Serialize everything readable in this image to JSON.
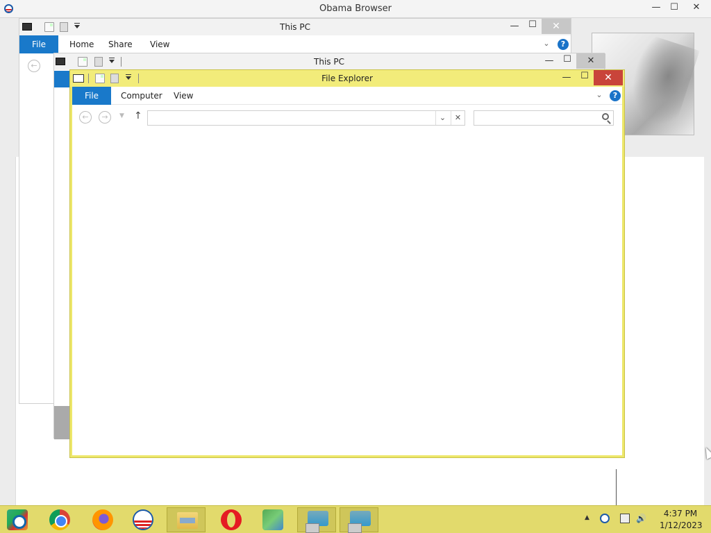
{
  "browser": {
    "title": "Obama Browser",
    "minimize": "—",
    "maximize": "☐",
    "close": "✕"
  },
  "window_a": {
    "title": "This PC",
    "tabs": [
      "File",
      "Home",
      "Share",
      "View"
    ],
    "help": "?",
    "expand": "⌄",
    "minimize": "—",
    "maximize": "☐",
    "close": "✕"
  },
  "window_b": {
    "title": "This PC",
    "minimize": "—",
    "maximize": "☐",
    "close": "✕"
  },
  "file_explorer": {
    "title": "File Explorer",
    "tabs": [
      "File",
      "Computer",
      "View"
    ],
    "help": "?",
    "expand": "⌄",
    "minimize": "—",
    "maximize": "☐",
    "close": "✕",
    "nav": {
      "back": "←",
      "forward": "→",
      "recent": "▼",
      "up": "↑"
    },
    "address": {
      "value": "",
      "dropdown": "⌄",
      "clear": "✕"
    },
    "search": {
      "placeholder": ""
    }
  },
  "taskbar": {
    "items": [
      {
        "name": "start-button",
        "icon": "start-logo-icon",
        "active": false
      },
      {
        "name": "chrome",
        "icon": "chrome-icon",
        "active": false
      },
      {
        "name": "firefox",
        "icon": "firefox-icon",
        "active": false
      },
      {
        "name": "obama-browser",
        "icon": "obama-logo-icon",
        "active": false
      },
      {
        "name": "file-explorer",
        "icon": "folder-icon",
        "active": true
      },
      {
        "name": "opera",
        "icon": "opera-icon",
        "active": false
      },
      {
        "name": "people",
        "icon": "people-icon",
        "active": false
      },
      {
        "name": "this-pc-1",
        "icon": "computer-icon",
        "active": true
      },
      {
        "name": "this-pc-2",
        "icon": "computer-icon",
        "active": true
      }
    ],
    "tray": {
      "show_hidden": "▲",
      "volume": "🔊"
    },
    "clock": {
      "time": "4:37 PM",
      "date": "1/12/2023"
    }
  },
  "colors": {
    "accent_blue": "#1979ca",
    "explorer_frame": "#ede76a",
    "taskbar": "#e2da6c",
    "close_red": "#c9443a"
  }
}
